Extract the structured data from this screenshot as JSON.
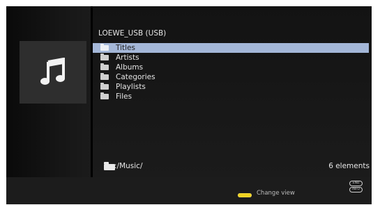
{
  "media_icon": "music-note-icon",
  "source": {
    "title": "LOEWE_USB (USB)"
  },
  "list": {
    "items": [
      {
        "label": "Titles",
        "icon": "folder-icon"
      },
      {
        "label": "Artists",
        "icon": "folder-icon"
      },
      {
        "label": "Albums",
        "icon": "folder-icon"
      },
      {
        "label": "Categories",
        "icon": "folder-icon"
      },
      {
        "label": "Playlists",
        "icon": "folder-icon"
      },
      {
        "label": "Files",
        "icon": "folder-icon"
      }
    ],
    "selected_index": 0
  },
  "status": {
    "path": ":/Music/",
    "count": "6 elements"
  },
  "hints": {
    "change_view": "Change view",
    "change_view_key_color": "#f0d21e",
    "end_key": "END",
    "info_key": "INFO"
  },
  "colors": {
    "selection": "#a4b7d8",
    "background": "#050505"
  }
}
